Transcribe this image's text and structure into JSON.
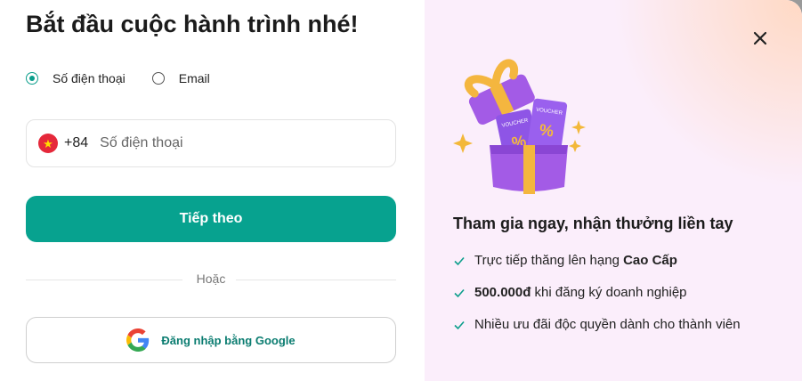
{
  "left": {
    "title": "Bắt đầu cuộc hành trình nhé!",
    "radio_options": [
      {
        "label": "Số điện thoại",
        "checked": true
      },
      {
        "label": "Email",
        "checked": false
      }
    ],
    "phone": {
      "country_code": "+84",
      "placeholder": "Số điện thoại",
      "value": ""
    },
    "next_label": "Tiếp theo",
    "divider_label": "Hoặc",
    "google_label": "Đăng nhập bằng Google"
  },
  "right": {
    "title": "Tham gia ngay, nhận thưởng liền tay",
    "benefits": [
      {
        "bold": "",
        "text": "Trực tiếp thăng lên hạng ",
        "bold_after": "Cao Cấp"
      },
      {
        "bold": "500.000đ",
        "text": " khi đăng ký doanh nghiệp",
        "bold_after": ""
      },
      {
        "bold": "",
        "text": "Nhiều ưu đãi độc quyền dành cho thành viên",
        "bold_after": ""
      }
    ],
    "voucher_label": "VOUCHER"
  },
  "colors": {
    "accent": "#07a28f",
    "flag_red": "#e5283a",
    "flag_star": "#ffde00",
    "right_bg": "#fbeefb"
  },
  "icons": {
    "close": "close-icon",
    "google": "google-icon",
    "check": "check-icon",
    "flag": "vietnam-flag-icon"
  }
}
